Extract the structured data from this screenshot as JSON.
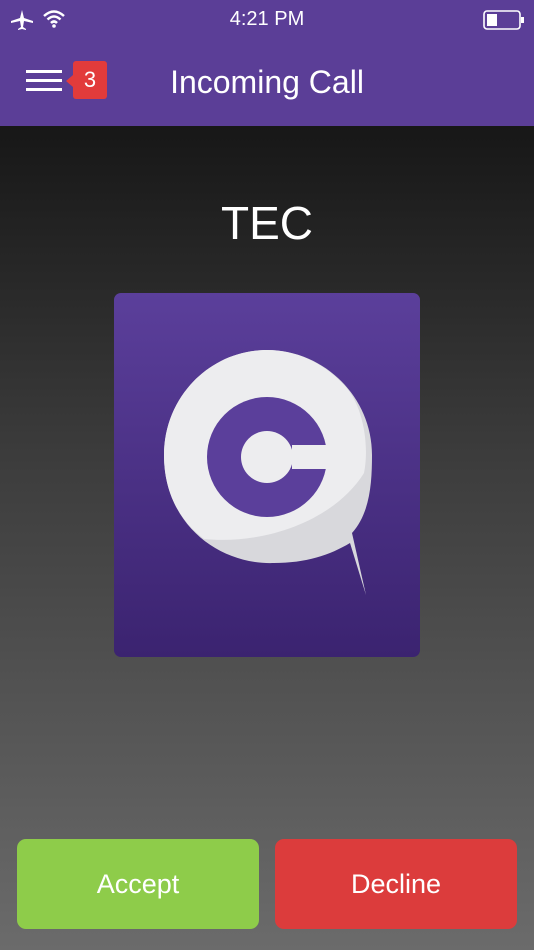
{
  "status_bar": {
    "time": "4:21 PM",
    "icons": [
      "airplane-icon",
      "wifi-icon",
      "battery-icon"
    ]
  },
  "header": {
    "title": "Incoming Call",
    "badge_count": "3",
    "menu_icon": "hamburger-menu-icon"
  },
  "call": {
    "caller_name": "TEC",
    "accept_label": "Accept",
    "decline_label": "Decline"
  },
  "colors": {
    "header_bg": "#5b3e97",
    "badge": "#e23b3b",
    "accept": "#8ecc4a",
    "decline": "#dc3c3c",
    "logo_purple": "#5b3f9b"
  }
}
